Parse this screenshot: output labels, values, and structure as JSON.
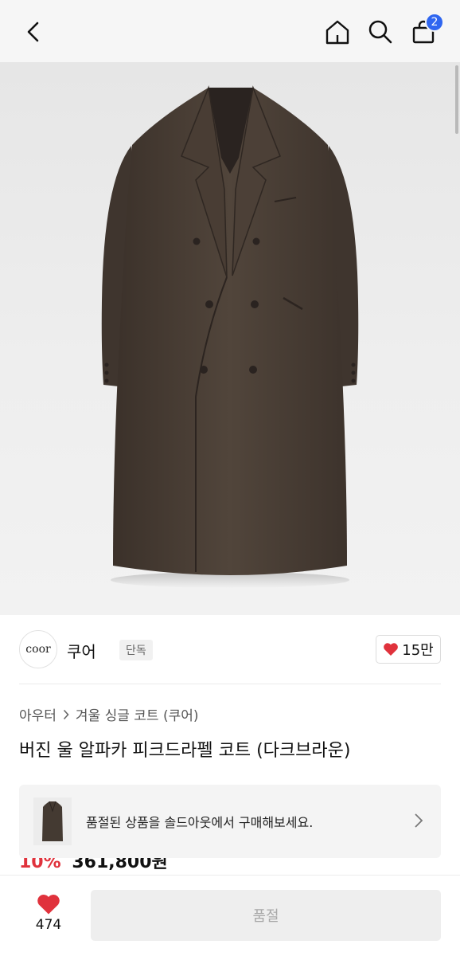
{
  "header": {
    "back_icon": "chevron-left-icon",
    "home_icon": "home-icon",
    "search_icon": "search-icon",
    "cart_icon": "shopping-bag-icon",
    "cart_count": "2"
  },
  "brand": {
    "logo_text": "coor",
    "name": "쿠어",
    "tag": "단독",
    "likes": "15만"
  },
  "breadcrumb": {
    "level1": "아우터",
    "level2": "겨울 싱글 코트 (쿠어)"
  },
  "product": {
    "title": "버진 울 알파카 피크드라펠 코트 (다크브라운)",
    "discount": "10%",
    "price": "361,800원"
  },
  "banner": {
    "text": "품절된 상품을 솔드아웃에서 구매해보세요."
  },
  "bottom": {
    "wish_count": "474",
    "buy_label": "품절"
  },
  "colors": {
    "accent_red": "#e0323c",
    "badge_blue": "#2f66f0",
    "coat_brown": "#4a3e35"
  }
}
